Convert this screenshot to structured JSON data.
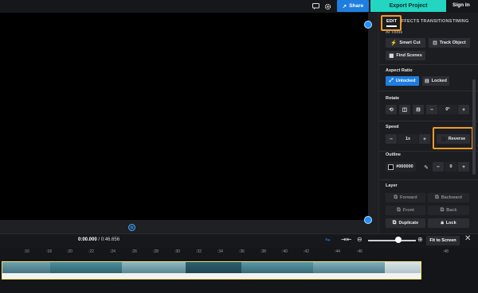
{
  "topbar": {
    "chat_icon": "comment-icon",
    "settings_icon": "gear-icon",
    "share_label": "Share",
    "export_label": "Export Project",
    "signin_label": "Sign In"
  },
  "tabs": [
    {
      "label": "EDIT"
    },
    {
      "label": "EFFECTS"
    },
    {
      "label": "TRANSITIONS"
    },
    {
      "label": "TIMING"
    }
  ],
  "tools": {
    "section_label": "AI Tools",
    "smart_cut": "Smart Cut",
    "track_object": "Track Object",
    "find_scenes": "Find Scenes"
  },
  "aspect_ratio": {
    "label": "Aspect Ratio",
    "unlocked": "Unlocked",
    "locked": "Locked"
  },
  "rotate": {
    "label": "Rotate",
    "value": "0°"
  },
  "speed": {
    "label": "Speed",
    "value": "1x",
    "reverse": "Reverse"
  },
  "outline": {
    "label": "Outline",
    "color": "#000000",
    "value": "0"
  },
  "layer": {
    "label": "Layer",
    "forward": "Forward",
    "backward": "Backward",
    "front": "Front",
    "back": "Back",
    "duplicate": "Duplicate",
    "lock": "Lock"
  },
  "timeline": {
    "current_time": "0:00.000",
    "total_time": "/ 0:46.656",
    "fit_label": "Fit to Screen",
    "ruler": [
      ":16",
      ":18",
      ":20",
      ":22",
      ":24",
      ":26",
      ":28",
      ":30",
      ":32",
      ":34",
      ":36",
      ":38",
      ":40",
      ":42",
      ":44",
      ":46",
      ":48"
    ]
  },
  "colors": {
    "accent": "#1e7ee0",
    "export": "#22d6c2",
    "highlight": "#f39a28",
    "clip_border": "#f2e26a"
  }
}
